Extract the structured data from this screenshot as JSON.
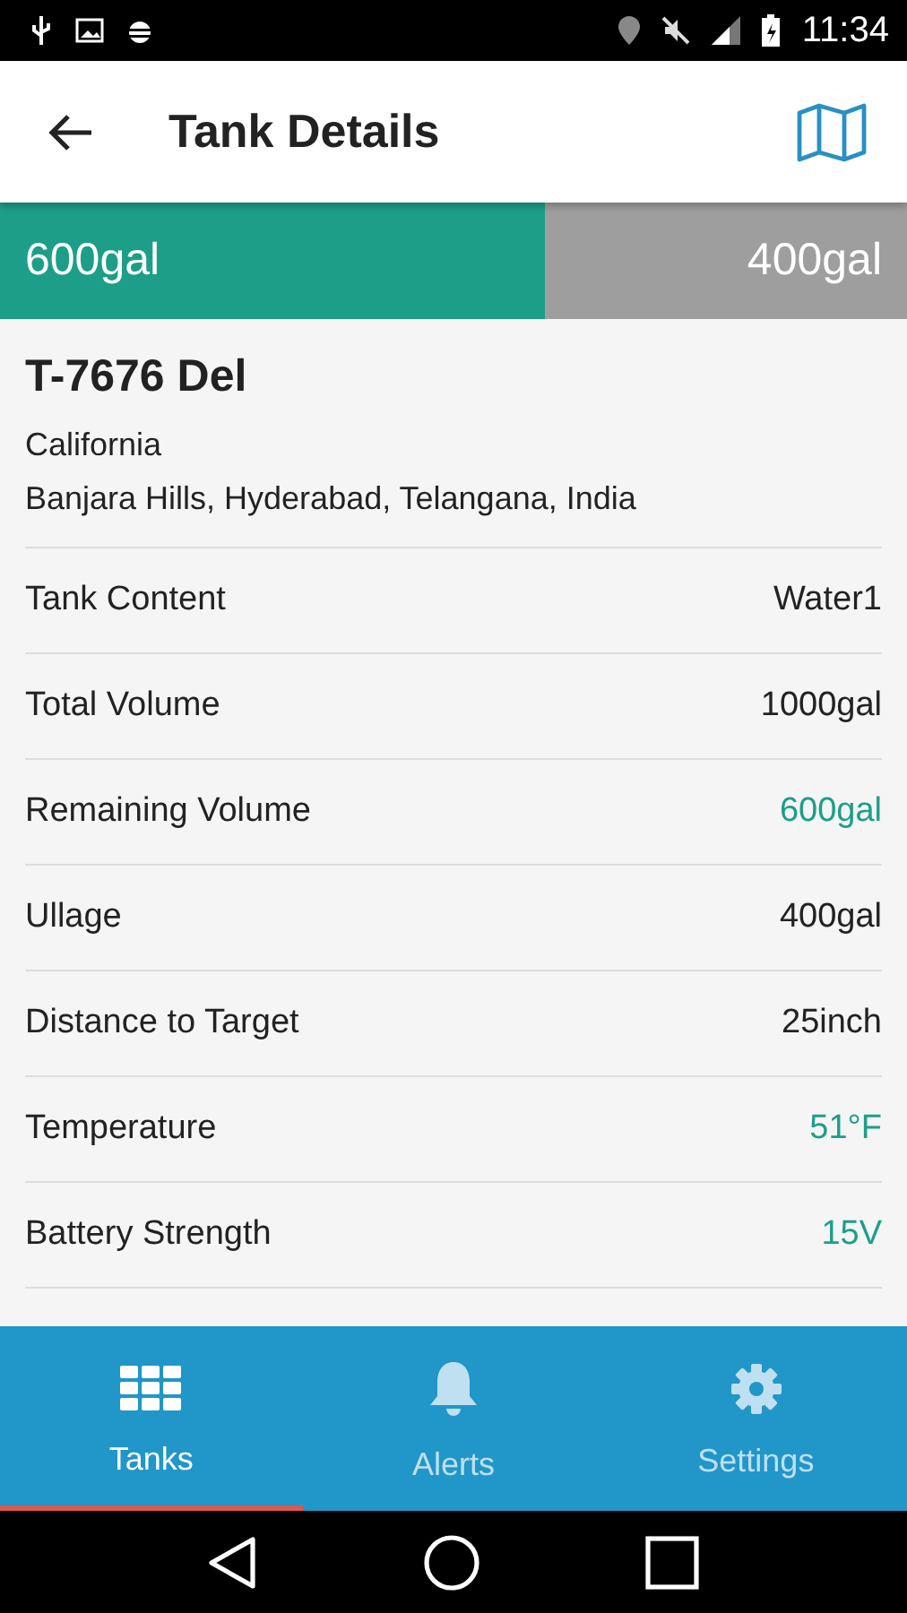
{
  "status_bar": {
    "time": "11:34"
  },
  "app_bar": {
    "title": "Tank Details"
  },
  "level_bar": {
    "level": 0.6,
    "filled_label": "600gal",
    "empty_label": "400gal"
  },
  "tank": {
    "name": "T-7676 Del",
    "region": "California",
    "address": "Banjara Hills, Hyderabad, Telangana, India"
  },
  "details": [
    {
      "label": "Tank Content",
      "value": "Water1",
      "highlighted": false
    },
    {
      "label": "Total Volume",
      "value": "1000gal",
      "highlighted": false
    },
    {
      "label": "Remaining Volume",
      "value": "600gal",
      "highlighted": true
    },
    {
      "label": "Ullage",
      "value": "400gal",
      "highlighted": false
    },
    {
      "label": "Distance to Target",
      "value": "25inch",
      "highlighted": false
    },
    {
      "label": "Temperature",
      "value": "51°F",
      "highlighted": true
    },
    {
      "label": "Battery Strength",
      "value": "15V",
      "highlighted": true
    }
  ],
  "bottom_nav": [
    {
      "kind": "grid",
      "label": "Tanks",
      "selected": true
    },
    {
      "kind": "bell",
      "label": "Alerts",
      "selected": false
    },
    {
      "kind": "gear",
      "label": "Settings",
      "selected": false
    }
  ]
}
